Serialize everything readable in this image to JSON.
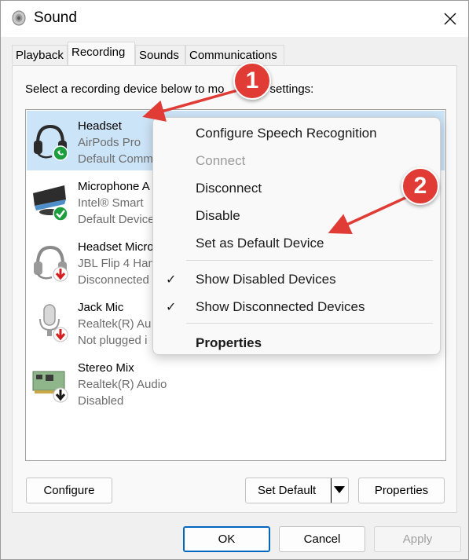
{
  "window": {
    "title": "Sound",
    "icon": "speaker-icon",
    "close_icon": "close-icon"
  },
  "tabs": [
    {
      "label": "Playback",
      "active": false
    },
    {
      "label": "Recording",
      "active": true
    },
    {
      "label": "Sounds",
      "active": false
    },
    {
      "label": "Communications",
      "active": false
    }
  ],
  "instruction": "Select a recording device below to modify its settings:",
  "instruction_visible_start": "Select a recording device below to mo",
  "instruction_visible_end": "settings:",
  "devices": [
    {
      "name": "Headset",
      "line2": "AirPods Pro",
      "line3": "Default Comm",
      "icon": "headset-icon",
      "status_icon": "phone-badge-icon",
      "selected": true
    },
    {
      "name": "Microphone A",
      "line2": "Intel® Smart",
      "line3": "Default Device",
      "icon": "webcam-microphone-icon",
      "status_icon": "checkmark-badge-icon",
      "selected": false
    },
    {
      "name": "Headset Micro",
      "line2": "JBL Flip 4 Han",
      "line3": "Disconnected",
      "icon": "headset-icon",
      "status_icon": "down-arrow-red-badge-icon",
      "selected": false
    },
    {
      "name": "Jack Mic",
      "line2": "Realtek(R) Au",
      "line3": "Not plugged i",
      "icon": "microphone-icon",
      "status_icon": "down-arrow-red-badge-icon",
      "selected": false
    },
    {
      "name": "Stereo Mix",
      "line2": "Realtek(R) Audio",
      "line3": "Disabled",
      "icon": "sound-card-icon",
      "status_icon": "down-arrow-black-badge-icon",
      "selected": false
    }
  ],
  "context_menu": {
    "items": [
      {
        "label": "Configure Speech Recognition",
        "enabled": true,
        "checked": false,
        "bold": false
      },
      {
        "label": "Connect",
        "enabled": false,
        "checked": false,
        "bold": false
      },
      {
        "label": "Disconnect",
        "enabled": true,
        "checked": false,
        "bold": false
      },
      {
        "label": "Disable",
        "enabled": true,
        "checked": false,
        "bold": false
      },
      {
        "label": "Set as Default Device",
        "enabled": true,
        "checked": false,
        "bold": false
      },
      {
        "label": "Show Disabled Devices",
        "enabled": true,
        "checked": true,
        "bold": false
      },
      {
        "label": "Show Disconnected Devices",
        "enabled": true,
        "checked": true,
        "bold": false
      },
      {
        "label": "Properties",
        "enabled": true,
        "checked": false,
        "bold": true
      }
    ],
    "check_glyph": "✓"
  },
  "panel_buttons": {
    "configure": "Configure",
    "set_default": "Set Default",
    "set_default_arrow_icon": "dropdown-triangle-icon",
    "properties": "Properties"
  },
  "dialog_buttons": {
    "ok": "OK",
    "cancel": "Cancel",
    "apply": "Apply",
    "apply_enabled": false
  },
  "annotations": [
    {
      "label": "1",
      "color": "#e03b35"
    },
    {
      "label": "2",
      "color": "#e03b35"
    }
  ]
}
